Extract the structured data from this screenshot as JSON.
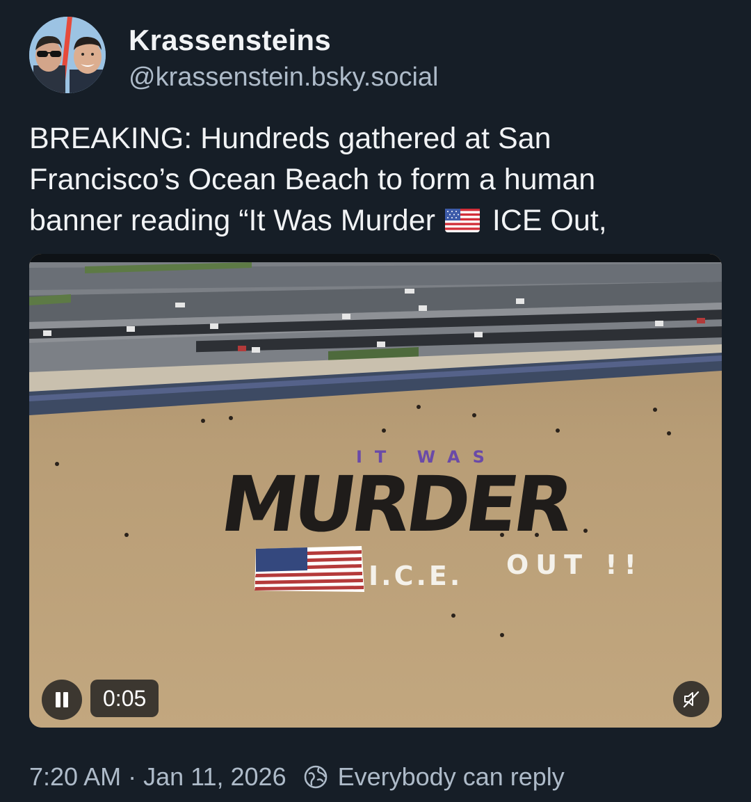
{
  "author": {
    "display_name": "Krassensteins",
    "handle": "@krassenstein.bsky.social"
  },
  "post": {
    "text_lines": [
      "BREAKING: Hundreds gathered at San",
      "Francisco’s Ocean Beach to form a human"
    ],
    "line3_before_emoji": "banner reading “It Was Murder",
    "line3_after_emoji": "ICE Out,",
    "emoji": "us-flag-emoji"
  },
  "video": {
    "elapsed_time": "0:05",
    "state": "playing",
    "muted": true,
    "scene_banner": {
      "line1": "IT  WAS",
      "line2": "MURDER",
      "line3": "I.C.E.",
      "line4": "OUT  !!"
    },
    "icons": {
      "pause": "pause-icon",
      "mute": "speaker-muted-icon"
    }
  },
  "footer": {
    "time": "7:20 AM",
    "separator": "·",
    "date": "Jan 11, 2026",
    "reply_setting": "Everybody can reply",
    "reply_icon": "globe-icon"
  },
  "colors": {
    "background": "#161e27",
    "primary_text": "#f1f3f5",
    "secondary_text": "#aebbc9"
  }
}
